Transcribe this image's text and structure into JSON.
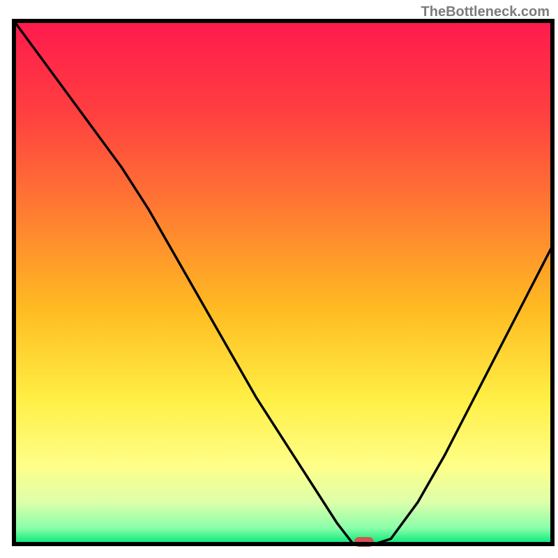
{
  "watermark": "TheBottleneck.com",
  "chart_data": {
    "type": "line",
    "title": "",
    "xlabel": "",
    "ylabel": "",
    "xlim": [
      0,
      100
    ],
    "ylim": [
      0,
      100
    ],
    "x": [
      0,
      5,
      10,
      15,
      20,
      25,
      30,
      35,
      40,
      45,
      50,
      55,
      60,
      63,
      67,
      70,
      75,
      80,
      85,
      90,
      95,
      100
    ],
    "values": [
      100,
      93,
      86,
      79,
      72,
      64,
      55,
      46,
      37,
      28,
      20,
      12,
      4,
      0,
      0,
      1,
      8,
      17,
      27,
      37,
      47,
      57
    ],
    "optimum_marker": {
      "x": 65,
      "y": 0
    },
    "background": "gradient-red-orange-yellow-green",
    "grid": false
  },
  "colors": {
    "gradient_top": "#ff1a4d",
    "gradient_mid1": "#ff5533",
    "gradient_mid2": "#ffaa22",
    "gradient_mid3": "#ffdd33",
    "gradient_mid4": "#ffff66",
    "gradient_mid5": "#ddff88",
    "gradient_bottom": "#00e676",
    "line": "#000000",
    "marker": "#d85050",
    "frame": "#000000"
  }
}
